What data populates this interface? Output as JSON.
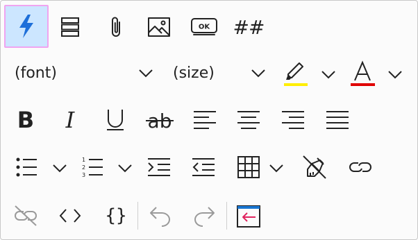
{
  "toolbar": {
    "font_combo": {
      "value": "(font)"
    },
    "size_combo": {
      "value": "(size)"
    },
    "colors": {
      "active_bg": "#cce6ff",
      "active_border": "#f0a4f0",
      "lightning": "#1e6fd9",
      "highlight_bar": "#ffee00",
      "font_color_bar": "#e00000",
      "embed_accent": "#1976d2",
      "embed_arrow": "#e0245e"
    },
    "ok_button_label": "OK",
    "markdown_label": "##",
    "icons": [
      "lightning-icon",
      "rows-icon",
      "paperclip-icon",
      "image-icon",
      "ok-button-icon",
      "markdown-hash-icon",
      "highlight-marker-icon",
      "font-color-icon",
      "bold-icon",
      "italic-icon",
      "underline-icon",
      "strikethrough-icon",
      "align-left-icon",
      "align-center-icon",
      "align-right-icon",
      "justify-icon",
      "bullet-list-icon",
      "numbered-list-icon",
      "indent-icon",
      "outdent-icon",
      "table-icon",
      "clear-formatting-icon",
      "link-icon",
      "unlink-icon",
      "code-icon",
      "code-block-icon",
      "undo-icon",
      "redo-icon",
      "embed-icon"
    ]
  }
}
